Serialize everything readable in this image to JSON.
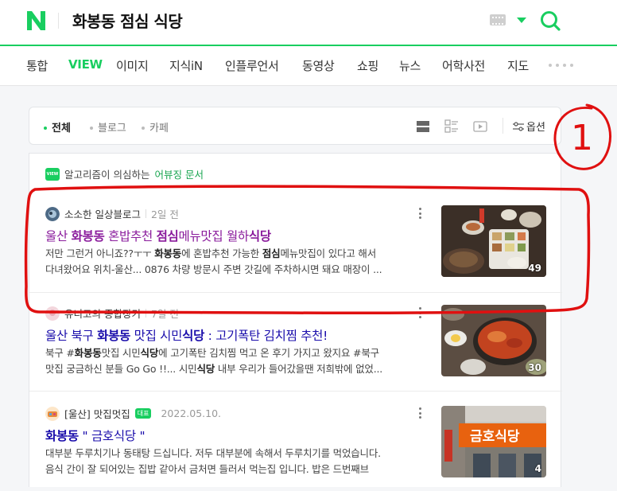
{
  "header": {
    "logo": "N",
    "query": "화봉동 점심 식당"
  },
  "tabs": [
    "통합",
    "VIEW",
    "이미지",
    "지식iN",
    "인플루언서",
    "동영상",
    "쇼핑",
    "뉴스",
    "어학사전",
    "지도"
  ],
  "filters": {
    "all": "전체",
    "blog": "블로그",
    "cafe": "카페",
    "options": "옵션"
  },
  "notice": {
    "badge": "VIEW",
    "text": "알고리즘이 의심하는",
    "link": "어뷰징 문서"
  },
  "results": [
    {
      "author": "소소한 일상블로그",
      "date": "2일 전",
      "title_pre": "울산 ",
      "title_b1": "화봉동",
      "title_mid": " 혼밥추천 ",
      "title_b2": "점심",
      "title_mid2": "메뉴맛집 월하",
      "title_b3": "식당",
      "desc_1_pre": "저만 그런거 아니죠??ㅜㅜ ",
      "desc_1_b": "화봉동",
      "desc_1_mid": "에 혼밥추천 가능한 ",
      "desc_1_b2": "점심",
      "desc_1_post": "메뉴맛집이 있다고 해서",
      "desc_2": "다녀왔어요 위치-울산... 0876 차량 방문시 주변 갓길에 주차하시면 돼요 매장이 ...",
      "thumb_count": "49"
    },
    {
      "author": "유니코의 종합장기",
      "date": "7일 전",
      "title_pre": "울산 북구 ",
      "title_b1": "화봉동",
      "title_mid": " 맛집 시민",
      "title_b2": "식당",
      "title_post": " : 고기폭탄 김치찜 추천!",
      "desc_1_pre": "북구 #",
      "desc_1_b": "화봉동",
      "desc_1_mid": "맛집 시민",
      "desc_1_b2": "식당",
      "desc_1_post": "에 고기폭탄 김치찜 먹고 온 후기 가지고 왔지요 #북구",
      "desc_2_pre": "맛집 궁금하신 분들 Go Go !!... 시민",
      "desc_2_b": "식당",
      "desc_2_post": " 내부 우리가 들어갔을땐 저희밖에 없었...",
      "thumb_count": "30"
    },
    {
      "author": "[울산] 맛집멋집",
      "rep_badge": "대표",
      "date": "2022.05.10.",
      "title_b1": "화봉동",
      "title_post": " \" 금호식당 \"",
      "desc_1": "대부분 두루치기나 동태탕 드십니다. 저두 대부분에 속해서 두루치기를 먹었습니다.",
      "desc_2": "음식 간이 잘 되어있는 집밥 같아서 금처면 들러서 먹는집 입니다. 밥은 드번째브",
      "thumb_count": "4",
      "sign_text": "금호식당"
    }
  ],
  "annotation": {
    "mark": "1",
    "color": "#e01010"
  },
  "colors": {
    "brand": "#19ce60",
    "link": "#1a0dab",
    "visited": "#8a1b9c"
  }
}
